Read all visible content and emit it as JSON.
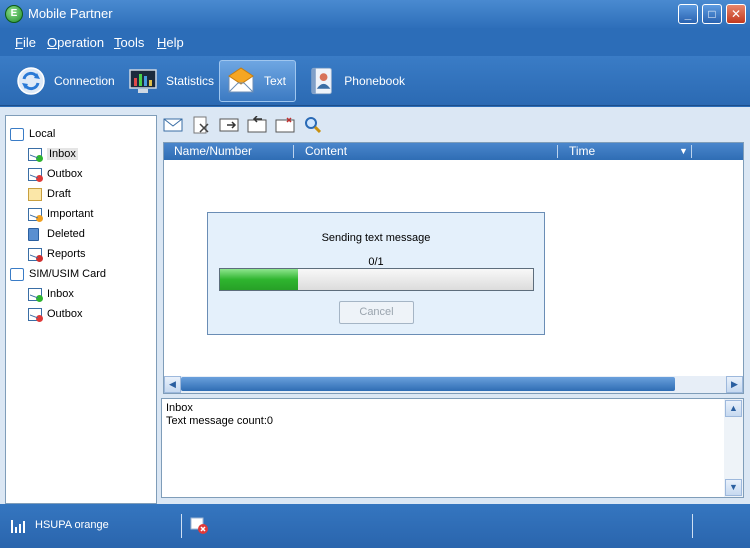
{
  "window": {
    "title": "Mobile Partner",
    "app_icon_letter": "E"
  },
  "menu": [
    {
      "key": "F",
      "rest": "ile"
    },
    {
      "key": "O",
      "rest": "peration"
    },
    {
      "key": "T",
      "rest": "ools"
    },
    {
      "key": "H",
      "rest": "elp"
    }
  ],
  "tabs": [
    {
      "label": "Connection",
      "icon": "connection-icon"
    },
    {
      "label": "Statistics",
      "icon": "statistics-icon"
    },
    {
      "label": "Text",
      "icon": "text-message-icon",
      "active": true
    },
    {
      "label": "Phonebook",
      "icon": "phonebook-icon"
    }
  ],
  "tree": {
    "local_label": "Local",
    "local_items": [
      "Inbox",
      "Outbox",
      "Draft",
      "Important",
      "Deleted",
      "Reports"
    ],
    "sim_label": "SIM/USIM Card",
    "sim_items": [
      "Inbox",
      "Outbox"
    ],
    "selected": "Inbox"
  },
  "list": {
    "columns": [
      "Name/Number",
      "Content",
      "Time"
    ]
  },
  "dialog": {
    "title": "Sending text message",
    "count": "0/1",
    "progress": 0.25,
    "cancel_label": "Cancel"
  },
  "info": {
    "folder": "Inbox",
    "count_text": "Text message count:0"
  },
  "status": {
    "network": "HSUPA orange"
  },
  "colors": {
    "accent": "#2c6db8",
    "progress": "#2fb52f"
  }
}
